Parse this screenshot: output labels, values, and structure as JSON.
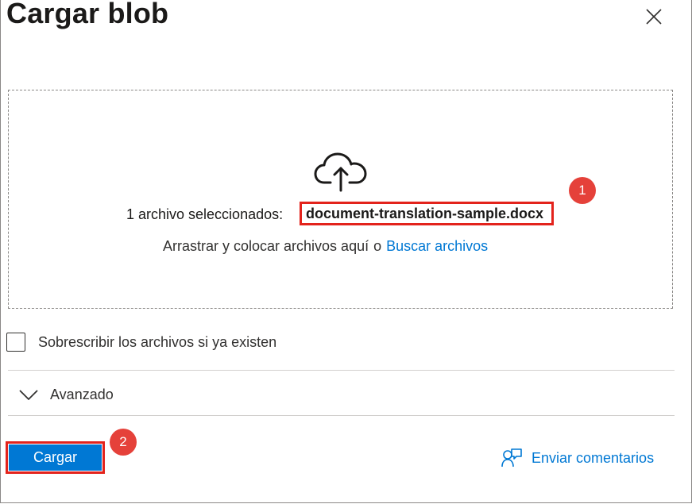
{
  "header": {
    "title": "Cargar blob",
    "close_icon": "close-icon"
  },
  "dropzone": {
    "upload_icon": "cloud-upload-icon",
    "selected_label": "1 archivo seleccionados:",
    "file_name": "document-translation-sample.docx",
    "drag_text": "Arrastrar y colocar archivos aquí",
    "or_text": "o",
    "browse_link": "Buscar archivos"
  },
  "options": {
    "overwrite_label": "Sobrescribir los archivos si ya existen",
    "overwrite_checked": false
  },
  "advanced": {
    "label": "Avanzado",
    "expanded": false
  },
  "footer": {
    "upload_label": "Cargar",
    "feedback_label": "Enviar comentarios",
    "feedback_icon": "feedback-icon"
  },
  "annotations": {
    "badge_1": "1",
    "badge_2": "2"
  },
  "colors": {
    "accent": "#0078d4",
    "highlight": "#e3231c",
    "badge": "#e5413a"
  }
}
